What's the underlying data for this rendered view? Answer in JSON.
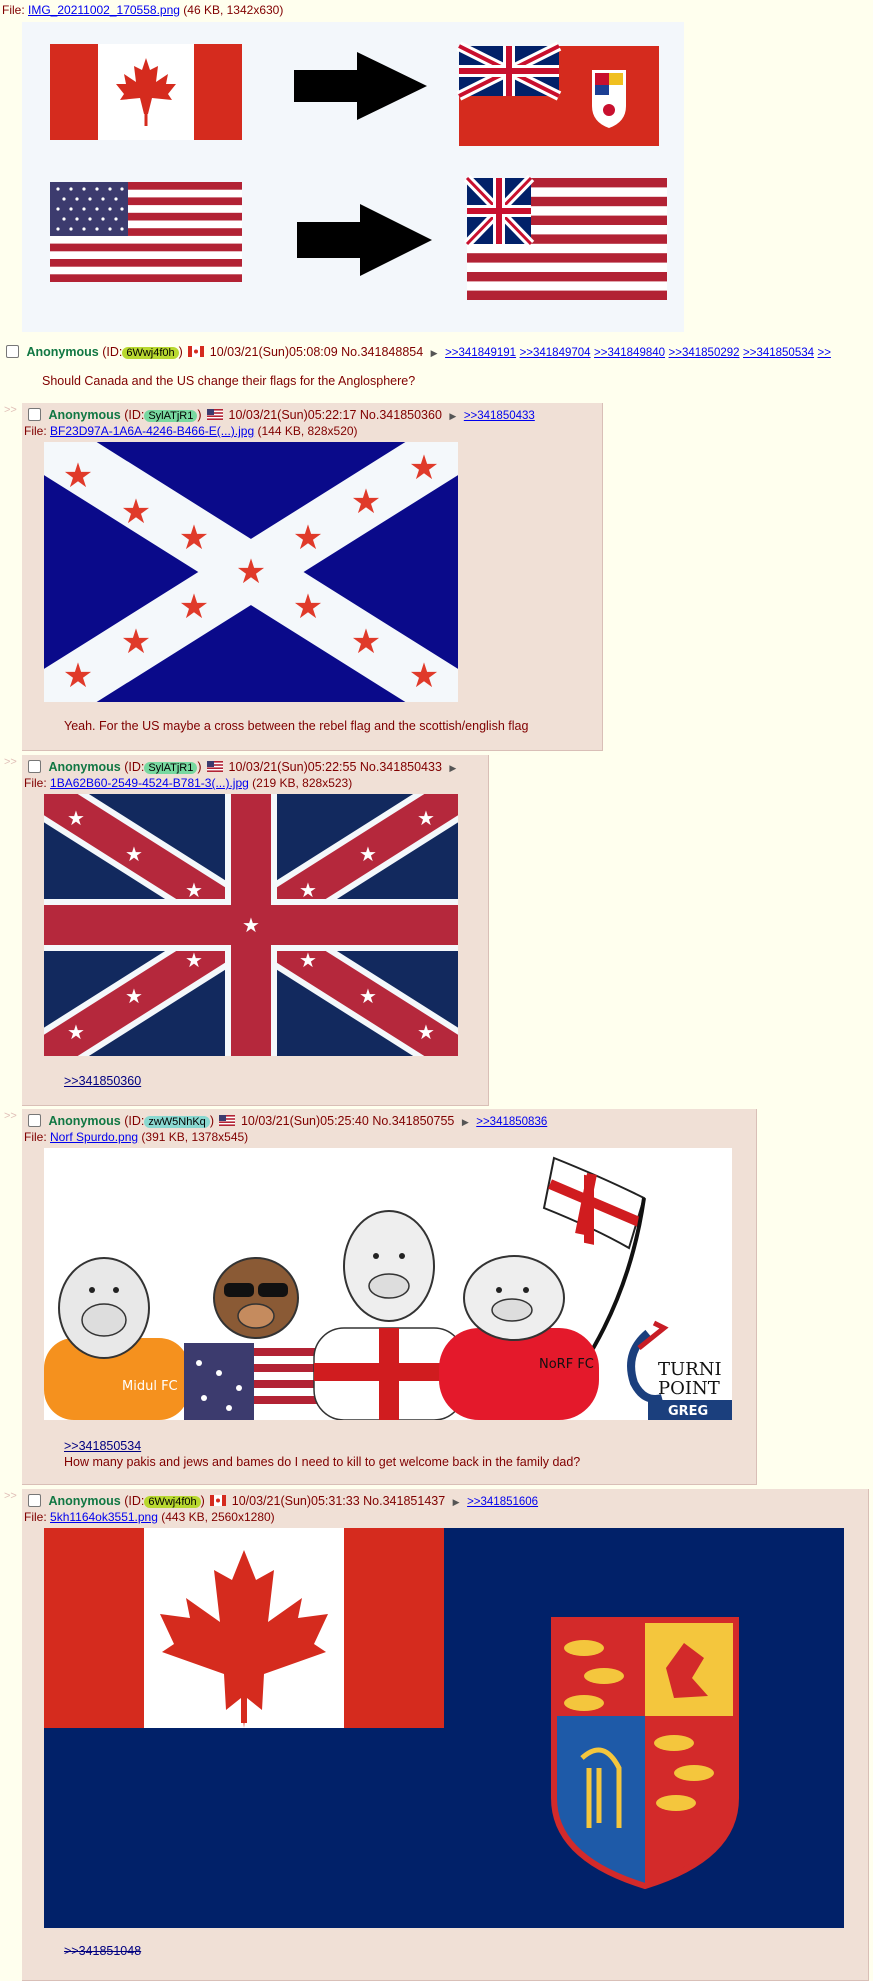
{
  "op": {
    "file_label": "File:",
    "file_name": "IMG_20211002_170558.png",
    "file_meta": "(46 KB, 1342x630)",
    "name": "Anonymous",
    "id_prefix": "(ID:",
    "id": "6Wwj4f0h",
    "id_color": "#b8d830",
    "id_suffix": ")",
    "datetime": "10/03/21(Sun)05:08:09",
    "no": "No.341848854",
    "replies": [
      ">>341849191",
      ">>341849704",
      ">>341849840",
      ">>341850292",
      ">>341850534",
      ">>"
    ],
    "message": "Should Canada and the US change their flags for the Anglosphere?"
  },
  "posts": [
    {
      "name": "Anonymous",
      "id_prefix": "(ID:",
      "id": "SylATjR1",
      "id_color": "#78d8a0",
      "id_suffix": ")",
      "datetime": "10/03/21(Sun)05:22:17",
      "no": "No.341850360",
      "backlinks": [
        ">>341850433"
      ],
      "file_label": "File:",
      "file_name": "BF23D97A-1A6A-4246-B466-E(...).jpg",
      "file_meta": "(144 KB, 828x520)",
      "message": "Yeah. For the US maybe a cross between the rebel flag and the scottish/english flag"
    },
    {
      "name": "Anonymous",
      "id_prefix": "(ID:",
      "id": "SylATjR1",
      "id_color": "#78d8a0",
      "id_suffix": ")",
      "datetime": "10/03/21(Sun)05:22:55",
      "no": "No.341850433",
      "backlinks": [],
      "file_label": "File:",
      "file_name": "1BA62B60-2549-4524-B781-3(...).jpg",
      "file_meta": "(219 KB, 828x523)",
      "quote": ">>341850360"
    },
    {
      "name": "Anonymous",
      "id_prefix": "(ID:",
      "id": "zwW5NhKq",
      "id_color": "#8ad8d0",
      "id_suffix": ")",
      "datetime": "10/03/21(Sun)05:25:40",
      "no": "No.341850755",
      "backlinks": [
        ">>341850836"
      ],
      "file_label": "File:",
      "file_name": "Norf Spurdo.png",
      "file_meta": "(391 KB, 1378x545)",
      "quote": ">>341850534",
      "message": "How many pakis and jews and bames do I need to kill to get welcome back in the family dad?",
      "image_text": {
        "left_shirt": "Midul FC",
        "right_shirt": "NoRF FC",
        "logo_line1": "TURNI",
        "logo_line2": "POINT",
        "logo_line3": "GREG"
      }
    },
    {
      "name": "Anonymous",
      "id_prefix": "(ID:",
      "id": "6Wwj4f0h",
      "id_color": "#b8d830",
      "id_suffix": ")",
      "datetime": "10/03/21(Sun)05:31:33",
      "no": "No.341851437",
      "backlinks": [
        ">>341851606"
      ],
      "file_label": "File:",
      "file_name": "5kh1164ok3551.png",
      "file_meta": "(443 KB, 2560x1280)",
      "quote": ">>341851048"
    }
  ],
  "colors": {
    "link": "#0000ee",
    "name": "#117743",
    "text": "#800000",
    "reply_bg": "#f0e0d6",
    "page_bg": "#ffffee",
    "flag_red": "#d52b1e",
    "us_blue": "#3c3b6e",
    "ensign_blue": "#012169"
  }
}
